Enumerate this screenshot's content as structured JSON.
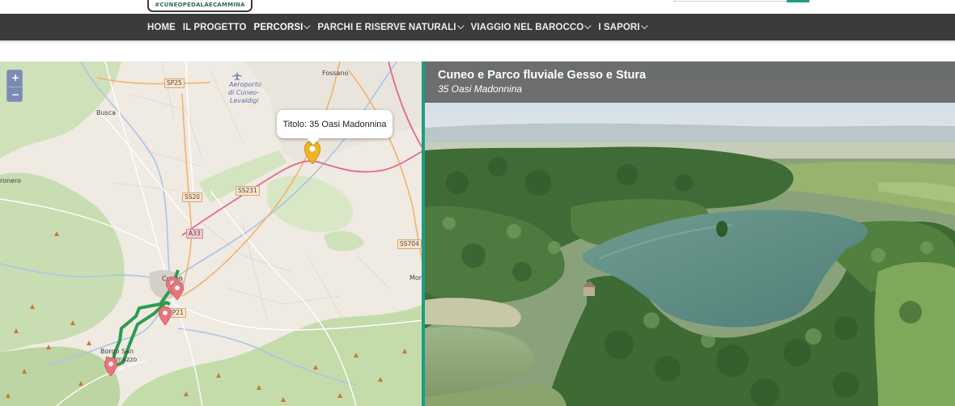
{
  "header": {
    "logo_text": "#CUNEOPEDALAECAMMINA"
  },
  "nav": {
    "items": [
      {
        "label": "HOME",
        "has_dropdown": false,
        "active": false
      },
      {
        "label": "IL PROGETTO",
        "has_dropdown": false,
        "active": false
      },
      {
        "label": "PERCORSI",
        "has_dropdown": true,
        "active": true
      },
      {
        "label": "PARCHI E RISERVE NATURALI",
        "has_dropdown": true,
        "active": false
      },
      {
        "label": "VIAGGIO NEL BAROCCO",
        "has_dropdown": true,
        "active": false
      },
      {
        "label": "I SAPORI",
        "has_dropdown": true,
        "active": false
      }
    ]
  },
  "map": {
    "zoom_in": "+",
    "zoom_out": "−",
    "popup_text": "Titolo: 35 Oasi Madonnina",
    "labels": {
      "fossano": "Fossano",
      "aeroporto": "Aeroporto",
      "di_cuneo": "di Cuneo-",
      "levaldigi": "Levaldigi",
      "busca": "Busca",
      "dronero": "ronero",
      "cuneo": "Cuneo",
      "borgo": "Borgo San",
      "dalmazzo": "Dalmazzo",
      "mon": "Mon"
    },
    "road_shields": {
      "sp25": "SP25",
      "ss20": "SS20",
      "ss231": "SS231",
      "a33": "A33",
      "ss704": "SS704",
      "sp21": "SP21"
    },
    "colors": {
      "route": "#2e9b4f",
      "pin_selected": "#f0b323",
      "pin": "#e8747c",
      "motorway": "#e26b87"
    }
  },
  "photo": {
    "title": "Cuneo e Parco fluviale Gesso e Stura",
    "subtitle": "35 Oasi Madonnina"
  },
  "theme": {
    "accent": "#1c9c84",
    "nav_bg": "#3b3b3b"
  }
}
